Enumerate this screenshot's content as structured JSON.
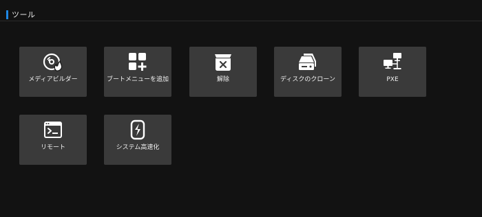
{
  "section": {
    "title": "ツール",
    "accent_color": "#1e88e5"
  },
  "tiles": [
    {
      "label": "メディアビルダー",
      "icon": "disc-burn-icon"
    },
    {
      "label": "ブートメニューを追加",
      "icon": "add-grid-icon"
    },
    {
      "label": "解除",
      "icon": "uninstall-box-icon"
    },
    {
      "label": "ディスクのクローン",
      "icon": "disk-clone-icon"
    },
    {
      "label": "PXE",
      "icon": "network-computers-icon"
    },
    {
      "label": "リモート",
      "icon": "terminal-window-icon"
    },
    {
      "label": "システム高速化",
      "icon": "speedup-icon"
    }
  ],
  "colors": {
    "background": "#121212",
    "tile": "#3a3a3a",
    "icon": "#ffffff"
  }
}
